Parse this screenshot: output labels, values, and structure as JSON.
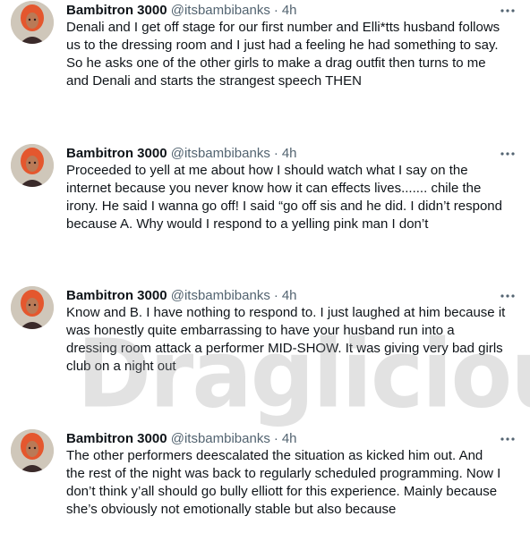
{
  "tweets": [
    {
      "name": "Bambitron 3000",
      "handle": "@itsbambibanks",
      "separator": "·",
      "time": "4h",
      "text": "Denali and I get off stage for our first number and Elli*tts husband follows\nus to the dressing room and I just had a feeling he had something to say.\nSo he asks one of the other girls to make a drag outfit then turns to me\nand Denali and starts the strangest speech THEN"
    },
    {
      "name": "Bambitron 3000",
      "handle": "@itsbambibanks",
      "separator": "·",
      "time": "4h",
      "text": "Proceeded to yell at me about how I should watch what I say on the\ninternet because you never know how it can effects lives....... chile the\nirony. He said I wanna go off! I said “go off sis and he did. I didn’t respond\nbecause A. Why would I respond to a yelling pink man I don’t"
    },
    {
      "name": "Bambitron 3000",
      "handle": "@itsbambibanks",
      "separator": "·",
      "time": "4h",
      "text": "Know and B. I have nothing to respond to. I just laughed at him because it\nwas honestly quite embarrassing to have your husband run into a\ndressing room attack a performer MID-SHOW. It was giving very bad girls\nclub on a night out"
    },
    {
      "name": "Bambitron 3000",
      "handle": "@itsbambibanks",
      "separator": "·",
      "time": "4h",
      "text": "The other performers deescalated the situation as kicked him out. And\nthe rest of the night was back to regularly scheduled programming. Now I\ndon’t think y’all should go bully elliott for this experience. Mainly because\nshe’s obviously not emotionally stable but also because"
    }
  ],
  "watermark": "Draglicious",
  "icons": {
    "avatar": "profile-photo",
    "more": "more-options-icon"
  },
  "colors": {
    "text": "#0f1419",
    "secondary": "#536471",
    "background": "#ffffff",
    "watermark": "#969696"
  }
}
